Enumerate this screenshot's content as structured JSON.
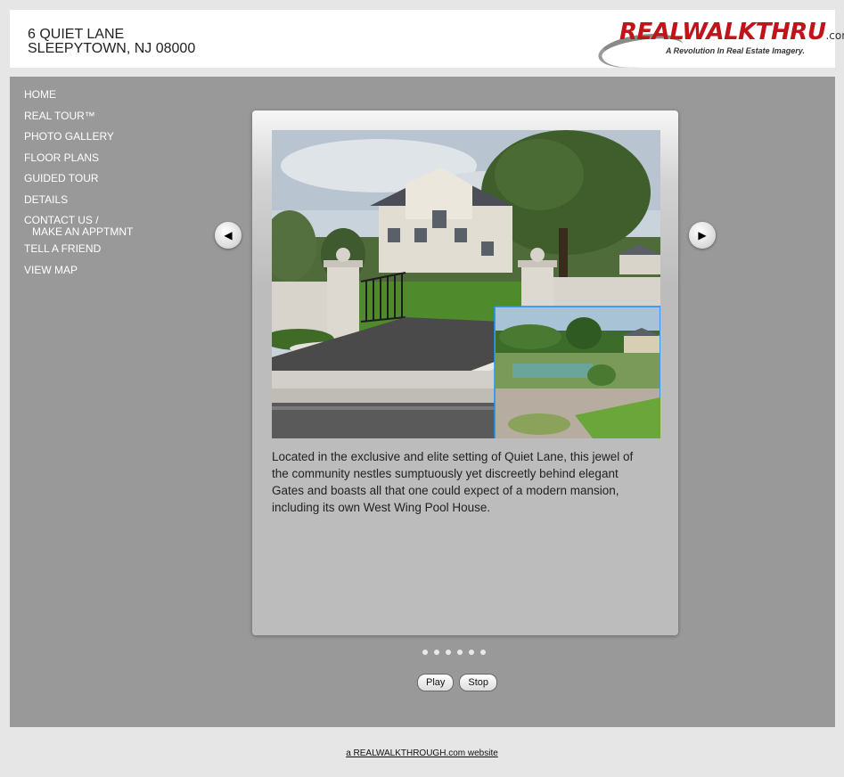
{
  "header": {
    "address_line1": "6 QUIET LANE",
    "address_line2": "SLEEPYTOWN, NJ 08000",
    "logo": {
      "name": "REALWALKTHRU",
      "suffix": ".com™",
      "tagline": "A Revolution In Real Estate Imagery."
    }
  },
  "nav": {
    "items": [
      {
        "label": "HOME"
      },
      {
        "label": "REAL TOUR™"
      },
      {
        "label": "PHOTO GALLERY"
      },
      {
        "label": "FLOOR PLANS"
      },
      {
        "label": "GUIDED TOUR"
      },
      {
        "label": "DETAILS"
      },
      {
        "label": "CONTACT US /",
        "label2": "MAKE AN APPTMNT"
      },
      {
        "label": "TELL A FRIEND"
      },
      {
        "label": "VIEW MAP"
      }
    ]
  },
  "slideshow": {
    "caption": "Located in the exclusive and elite setting of Quiet Lane, this jewel of the community nestles sumptuously yet discreetly behind elegant Gates and boasts all that one could expect of a modern mansion, including its own West Wing Pool House.",
    "prev_icon": "◀",
    "next_icon": "▶",
    "slide_count": 6,
    "current_slide": 1,
    "play_label": "Play",
    "stop_label": "Stop"
  },
  "footer": {
    "text": "a REALWALKTHROUGH.com website"
  },
  "colors": {
    "header_bg": "#ffffff",
    "page_bg": "#e6e6e6",
    "main_bg": "#999999",
    "brand_red": "#c0141a",
    "nav_text": "#ffffff"
  }
}
